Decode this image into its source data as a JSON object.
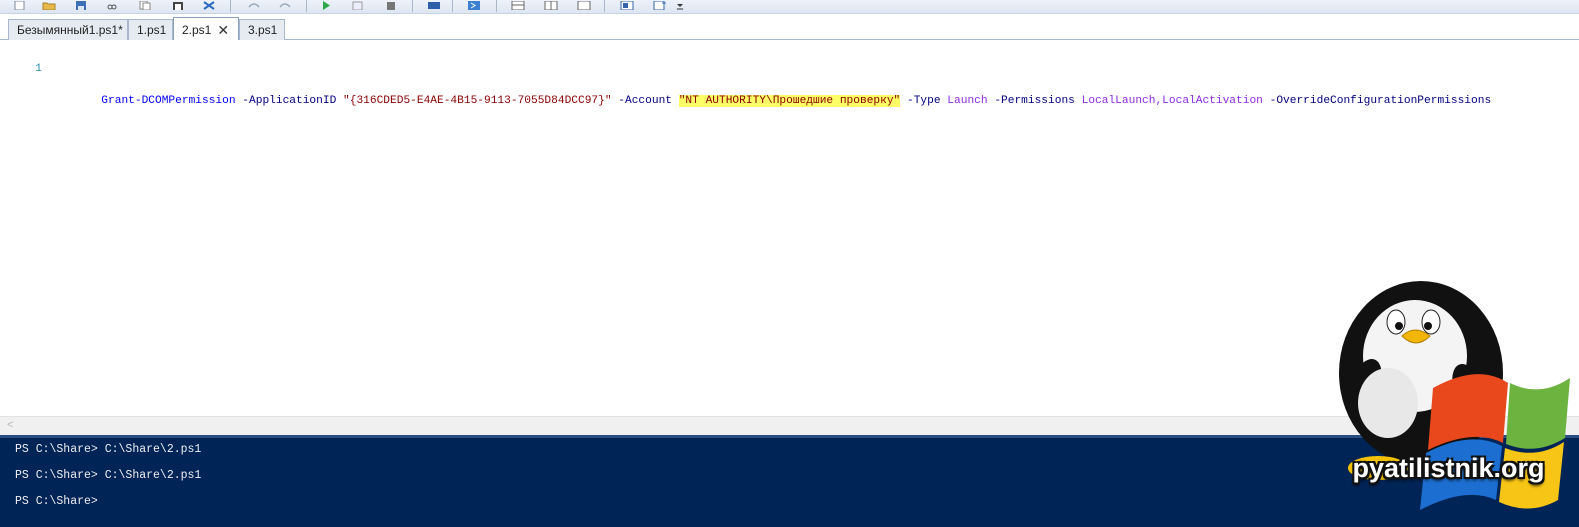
{
  "toolbar": {
    "icons": [
      "new-file-icon",
      "open-file-icon",
      "save-icon",
      "cut-icon",
      "copy-icon",
      "paste-icon",
      "clear-icon",
      "undo-icon",
      "redo-icon",
      "run-icon",
      "run-selection-icon",
      "stop-icon",
      "remote-powershell-icon",
      "start-powershell-icon",
      "show-script-pane-top-icon",
      "show-script-pane-right-icon",
      "show-script-pane-maximized-icon",
      "show-command-window-icon",
      "show-command-addon-icon",
      "toolbar-overflow-icon"
    ]
  },
  "tabs": [
    {
      "label": "Безымянный1.ps1*",
      "active": false
    },
    {
      "label": "1.ps1",
      "active": false
    },
    {
      "label": "2.ps1",
      "active": true,
      "close": "✕"
    },
    {
      "label": "3.ps1",
      "active": false
    }
  ],
  "editor": {
    "line_number": "1",
    "tokens": [
      {
        "text": "Grant-DCOMPermission",
        "kind": "cmd"
      },
      {
        "text": " ",
        "kind": "sp"
      },
      {
        "text": "-ApplicationID",
        "kind": "param"
      },
      {
        "text": " ",
        "kind": "sp"
      },
      {
        "text": "\"{316CDED5-E4AE-4B15-9113-7055D84DCC97}\"",
        "kind": "str"
      },
      {
        "text": " ",
        "kind": "sp"
      },
      {
        "text": "-Account",
        "kind": "param"
      },
      {
        "text": " ",
        "kind": "sp"
      },
      {
        "text": "\"NT AUTHORITY\\Прошедшие проверку\"",
        "kind": "str-hl"
      },
      {
        "text": " ",
        "kind": "sp"
      },
      {
        "text": "-Type",
        "kind": "param"
      },
      {
        "text": " ",
        "kind": "sp"
      },
      {
        "text": "Launch",
        "kind": "arg"
      },
      {
        "text": " ",
        "kind": "sp"
      },
      {
        "text": "-Permissions",
        "kind": "param"
      },
      {
        "text": " ",
        "kind": "sp"
      },
      {
        "text": "LocalLaunch,LocalActivation",
        "kind": "arg"
      },
      {
        "text": " ",
        "kind": "sp"
      },
      {
        "text": "-OverrideConfigurationPermissions",
        "kind": "param"
      }
    ]
  },
  "scrollbar": {
    "left_arrow": "<"
  },
  "console": {
    "lines": [
      "PS C:\\Share> C:\\Share\\2.ps1",
      "PS C:\\Share> C:\\Share\\2.ps1",
      "PS C:\\Share>"
    ]
  },
  "logo": {
    "text": "pyatilistnik.org"
  },
  "colors": {
    "console_bg": "#012456",
    "cmdlet": "#0000ff",
    "parameter": "#000080",
    "string": "#8b0000",
    "argument": "#8a2be2",
    "highlight": "#ffff66"
  }
}
